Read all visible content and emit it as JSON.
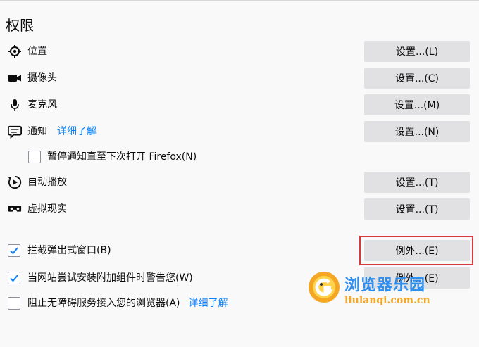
{
  "section_title": "权限",
  "permissions": {
    "location": {
      "label": "位置",
      "button": "设置...(L)"
    },
    "camera": {
      "label": "摄像头",
      "button": "设置...(C)"
    },
    "microphone": {
      "label": "麦克风",
      "button": "设置...(M)"
    },
    "notifications": {
      "label": "通知",
      "learn_more": "详细了解",
      "button": "设置...(N)"
    },
    "pause_notifications": {
      "label": "暂停通知直至下次打开 Firefox(N)",
      "checked": false
    },
    "autoplay": {
      "label": "自动播放",
      "button": "设置...(T)"
    },
    "vr": {
      "label": "虚拟现实",
      "button": "设置...(T)"
    }
  },
  "options": {
    "block_popups": {
      "label": "拦截弹出式窗口(B)",
      "checked": true,
      "button": "例外...(E)"
    },
    "warn_addons": {
      "label": "当网站尝试安装附加组件时警告您(W)",
      "checked": true,
      "button": "例外...(E)"
    },
    "block_a11y": {
      "label": "阻止无障碍服务接入您的浏览器(A)",
      "learn_more": "详细了解",
      "checked": false
    }
  },
  "watermark": {
    "title": "浏览器乐园",
    "url": "liulanqi.com.cn"
  },
  "colors": {
    "accent": "#0a84ff",
    "button_bg": "#e1e1e3",
    "highlight": "#d63a3f"
  }
}
